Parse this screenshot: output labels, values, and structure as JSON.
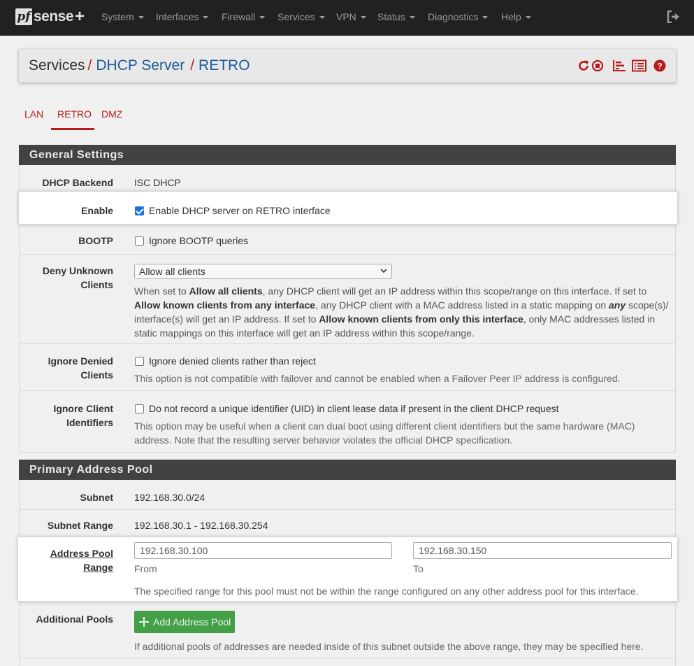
{
  "navbar": {
    "logo": {
      "pf": "pf",
      "sense": "sense",
      "plus": "+"
    },
    "menu": [
      "System",
      "Interfaces",
      "Firewall",
      "Services",
      "VPN",
      "Status",
      "Diagnostics",
      "Help"
    ],
    "logout_icon": "sign-out-icon"
  },
  "breadcrumb": {
    "root": "Services",
    "sep": "/",
    "level2": "DHCP Server",
    "level3": "RETRO",
    "icons": [
      "refresh-icon",
      "stop-circle-icon",
      "bar-chart-icon",
      "list-alt-icon",
      "help-circle-icon"
    ],
    "icon_color": "#b71c1c"
  },
  "tabs": {
    "items": [
      "LAN",
      "RETRO",
      "DMZ"
    ],
    "active": "RETRO"
  },
  "general": {
    "title": "General Settings",
    "backend": {
      "label": "DHCP Backend",
      "value": "ISC DHCP"
    },
    "enable": {
      "label": "Enable",
      "text": "Enable DHCP server on RETRO interface",
      "checked": true
    },
    "bootp": {
      "label": "BOOTP",
      "text": "Ignore BOOTP queries",
      "checked": false
    },
    "deny": {
      "label_1": "Deny Unknown",
      "label_2": "Clients",
      "selected": "Allow all clients",
      "help_1": "When set to ",
      "help_b1": "Allow all clients",
      "help_2": ", any DHCP client will get an IP address within this scope/range on this interface. If set to ",
      "help_b2": "Allow known clients from any interface",
      "help_3": ", any DHCP client with a MAC address listed in a static mapping on ",
      "help_i": "any",
      "help_4": " scope(s)/ interface(s) will get an IP address. If set to ",
      "help_b3": "Allow known clients from only this interface",
      "help_5": ", only MAC addresses listed in static mappings on this interface will get an IP address within this scope/range."
    },
    "ignore_denied": {
      "label_1": "Ignore Denied",
      "label_2": "Clients",
      "text": "Ignore denied clients rather than reject",
      "checked": false,
      "help": "This option is not compatible with failover and cannot be enabled when a Failover Peer IP address is configured."
    },
    "ignore_uid": {
      "label_1": "Ignore Client",
      "label_2": "Identifiers",
      "text": "Do not record a unique identifier (UID) in client lease data if present in the client DHCP request",
      "checked": false,
      "help": "This option may be useful when a client can dual boot using different client identifiers but the same hardware (MAC) address. Note that the resulting server behavior violates the official DHCP specification."
    }
  },
  "pool": {
    "title": "Primary Address Pool",
    "subnet": {
      "label": "Subnet",
      "value": "192.168.30.0/24"
    },
    "subnet_range": {
      "label": "Subnet Range",
      "value": "192.168.30.1 - 192.168.30.254"
    },
    "range": {
      "label": "Address Pool Range",
      "from_value": "192.168.30.100",
      "from_label": "From",
      "to_value": "192.168.30.150",
      "to_label": "To",
      "help": "The specified range for this pool must not be within the range configured on any other address pool for this interface."
    },
    "additional": {
      "label": "Additional Pools",
      "button": "Add Address Pool",
      "help": "If additional pools of addresses are needed inside of this subnet outside the above range, they may be specified here."
    }
  }
}
